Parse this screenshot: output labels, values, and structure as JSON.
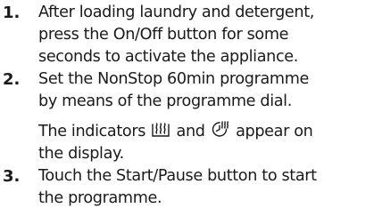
{
  "steps": [
    {
      "number": "1.",
      "lines": [
        "After loading laundry and detergent,",
        "press the On/Off button for some",
        "seconds to activate the appliance."
      ]
    },
    {
      "number": "2.",
      "lines": [
        "Set the NonStop 60min programme",
        "by means of the programme dial."
      ],
      "note": {
        "before": "The indicators",
        "middle": "and",
        "after": "appear on",
        "last_line": "the display.",
        "icons": [
          "steam-indicator-icon",
          "time-steam-indicator-icon"
        ]
      }
    },
    {
      "number": "3.",
      "lines": [
        "Touch the Start/Pause button to start",
        "the programme."
      ]
    }
  ]
}
